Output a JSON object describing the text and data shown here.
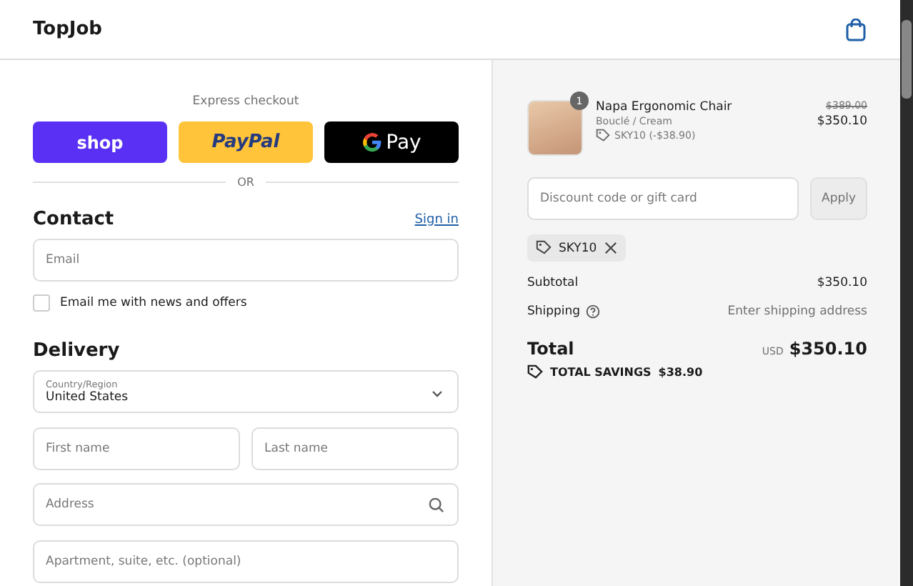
{
  "header": {
    "brand": "TopJob"
  },
  "express": {
    "title": "Express checkout",
    "buttons": [
      {
        "kind": "shop",
        "label": "shop"
      },
      {
        "kind": "paypal",
        "label": "PayPal"
      },
      {
        "kind": "gpay",
        "label": "Pay"
      }
    ],
    "divider": "OR"
  },
  "contact": {
    "title": "Contact",
    "link": "Sign in",
    "email": {
      "placeholder": "Email"
    },
    "newsletter": {
      "label": "Email me with news and offers",
      "checked": false
    }
  },
  "delivery": {
    "title": "Delivery",
    "country": {
      "label": "Country/Region",
      "value": "United States"
    },
    "first_name": {
      "placeholder": "First name"
    },
    "last_name": {
      "placeholder": "Last name"
    },
    "address": {
      "placeholder": "Address"
    },
    "apartment": {
      "placeholder": "Apartment, suite, etc. (optional)"
    }
  },
  "summary": {
    "item": {
      "quantity": "1",
      "name": "Napa Ergonomic Chair",
      "variant": "Bouclé / Cream",
      "discount": "SKY10 (-$38.90)",
      "old_price": "$389.00",
      "price": "$350.10"
    },
    "discount": {
      "placeholder": "Discount code or gift card",
      "button": "Apply",
      "applied": "SKY10"
    },
    "subtotal": {
      "label": "Subtotal",
      "value": "$350.10"
    },
    "shipping": {
      "label": "Shipping",
      "value": "Enter shipping address"
    },
    "total": {
      "label": "Total",
      "currency": "USD",
      "value": "$350.10"
    },
    "savings": {
      "label": "TOTAL SAVINGS",
      "value": "$38.90"
    }
  }
}
